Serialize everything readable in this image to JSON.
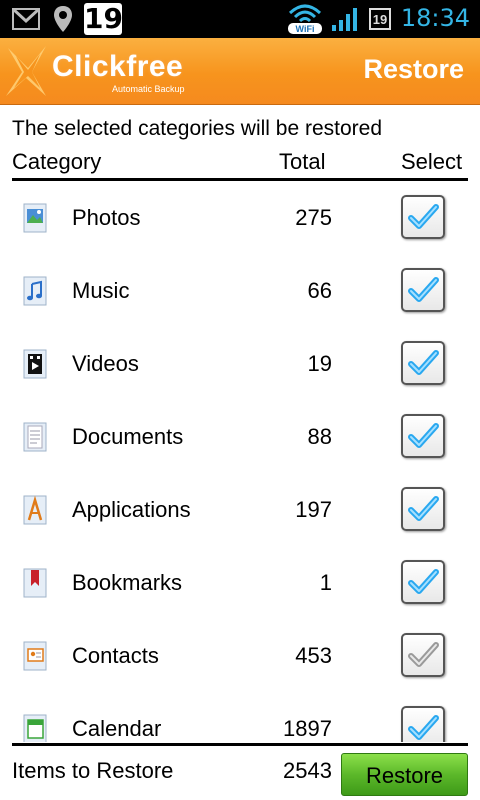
{
  "status_bar": {
    "date_badge": "19",
    "calendar_day": "19",
    "time": "18:34",
    "icons": [
      "gmail-icon",
      "location-icon",
      "calendar-date-icon",
      "wifi-icon",
      "signal-icon",
      "calendar-icon"
    ]
  },
  "header": {
    "logo_name": "Clickfree",
    "logo_tagline": "Automatic Backup",
    "title": "Restore",
    "colors": {
      "header_top": "#fbb040",
      "header_bottom": "#f58a1f"
    }
  },
  "subtitle": "The selected categories will be restored",
  "columns": {
    "category": "Category",
    "total": "Total",
    "select": "Select"
  },
  "categories": [
    {
      "label": "Photos",
      "total": "275",
      "icon": "photos-icon",
      "selected": true
    },
    {
      "label": "Music",
      "total": "66",
      "icon": "music-icon",
      "selected": true
    },
    {
      "label": "Videos",
      "total": "19",
      "icon": "videos-icon",
      "selected": true
    },
    {
      "label": "Documents",
      "total": "88",
      "icon": "documents-icon",
      "selected": true
    },
    {
      "label": "Applications",
      "total": "197",
      "icon": "applications-icon",
      "selected": true
    },
    {
      "label": "Bookmarks",
      "total": "1",
      "icon": "bookmarks-icon",
      "selected": true
    },
    {
      "label": "Contacts",
      "total": "453",
      "icon": "contacts-icon",
      "selected": false
    },
    {
      "label": "Calendar",
      "total": "1897",
      "icon": "calendar-icon",
      "selected": true
    }
  ],
  "footer": {
    "items_label": "Items to Restore",
    "items_total": "2543",
    "restore_button": "Restore"
  },
  "colors": {
    "accent_check": "#29a8f0",
    "status_time": "#34b5e5",
    "button_green": "#5cb82a"
  }
}
